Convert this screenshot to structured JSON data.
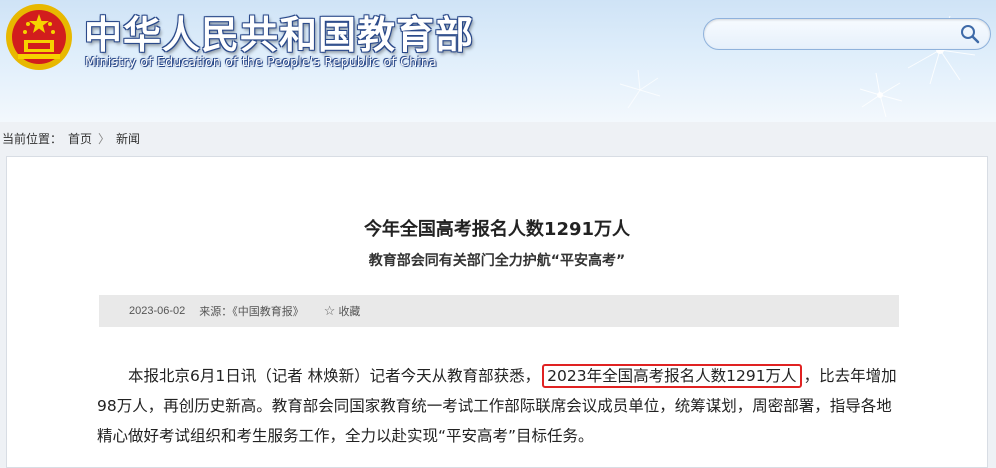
{
  "header": {
    "title_cn": "中华人民共和国教育部",
    "title_en": "Ministry of Education of the People's Republic of China",
    "search_placeholder": ""
  },
  "breadcrumb": {
    "prefix": "当前位置：",
    "items": [
      "首页",
      "新闻"
    ],
    "separator": "〉"
  },
  "article": {
    "title": "今年全国高考报名人数1291万人",
    "subtitle": "教育部会同有关部门全力护航“平安高考”",
    "date": "2023-06-02",
    "source": "来源：《中国教育报》",
    "favorite_label": "收藏",
    "body_before": "本报北京6月1日讯（记者 林焕新）记者今天从教育部获悉，",
    "body_highlight": "2023年全国高考报名人数1291万人",
    "body_after": "，比去年增加98万人，再创历史新高。教育部会同国家教育统一考试工作部际联席会议成员单位，统筹谋划，周密部署，指导各地精心做好考试组织和考生服务工作，全力以赴实现“平安高考”目标任务。",
    "highlight_color": "#e02222"
  }
}
